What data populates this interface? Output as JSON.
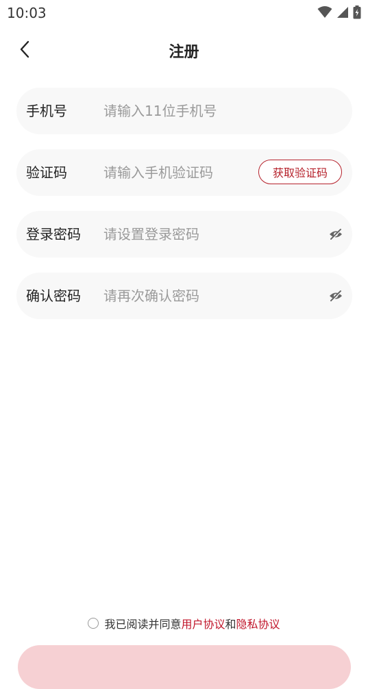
{
  "status_bar": {
    "time": "10:03"
  },
  "nav": {
    "title": "注册"
  },
  "form": {
    "phone": {
      "label": "手机号",
      "placeholder": "请输入11位手机号",
      "value": ""
    },
    "code": {
      "label": "验证码",
      "placeholder": "请输入手机验证码",
      "value": "",
      "button": "获取验证码"
    },
    "password": {
      "label": "登录密码",
      "placeholder": "请设置登录密码",
      "value": ""
    },
    "confirm": {
      "label": "确认密码",
      "placeholder": "请再次确认密码",
      "value": ""
    }
  },
  "agreement": {
    "prefix": "我已阅读并同意",
    "user_agreement": "用户协议",
    "and": "和",
    "privacy_agreement": "隐私协议"
  },
  "colors": {
    "accent": "#b5202a",
    "field_bg": "#f8f8f8",
    "submit_bg": "#f6d0d3"
  }
}
